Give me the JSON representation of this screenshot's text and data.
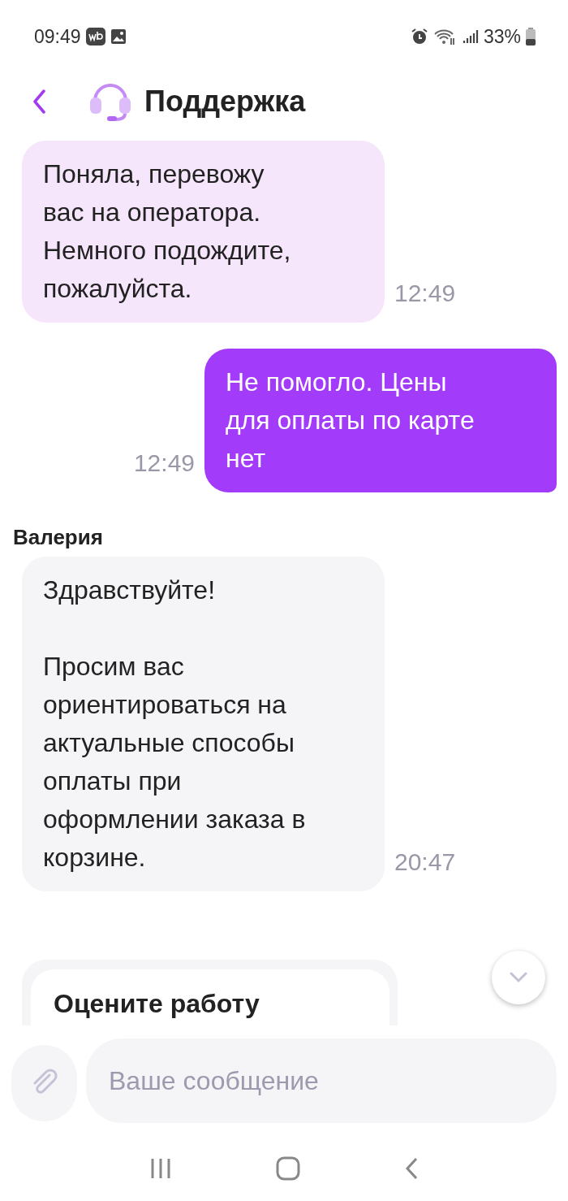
{
  "status_bar": {
    "time": "09:49",
    "battery": "33%"
  },
  "header": {
    "title": "Поддержка"
  },
  "messages": [
    {
      "kind": "incoming",
      "text": "Поняла, перевожу\nвас на оператора.\nНемного подождите,\nпожалуйста.",
      "time": "12:49"
    },
    {
      "kind": "outgoing",
      "text": "Не помогло. Цены\nдля оплаты по карте\nнет",
      "time": "12:49"
    },
    {
      "kind": "incoming",
      "sender": "Валерия",
      "text": "Здравствуйте!\n\nПросим вас\nориентироваться на\nактуальные способы\nоплаты при\nоформлении заказа в\nкорзине.",
      "time": "20:47"
    }
  ],
  "rating_card": {
    "title": "Оцените работу"
  },
  "composer": {
    "placeholder": "Ваше сообщение"
  }
}
